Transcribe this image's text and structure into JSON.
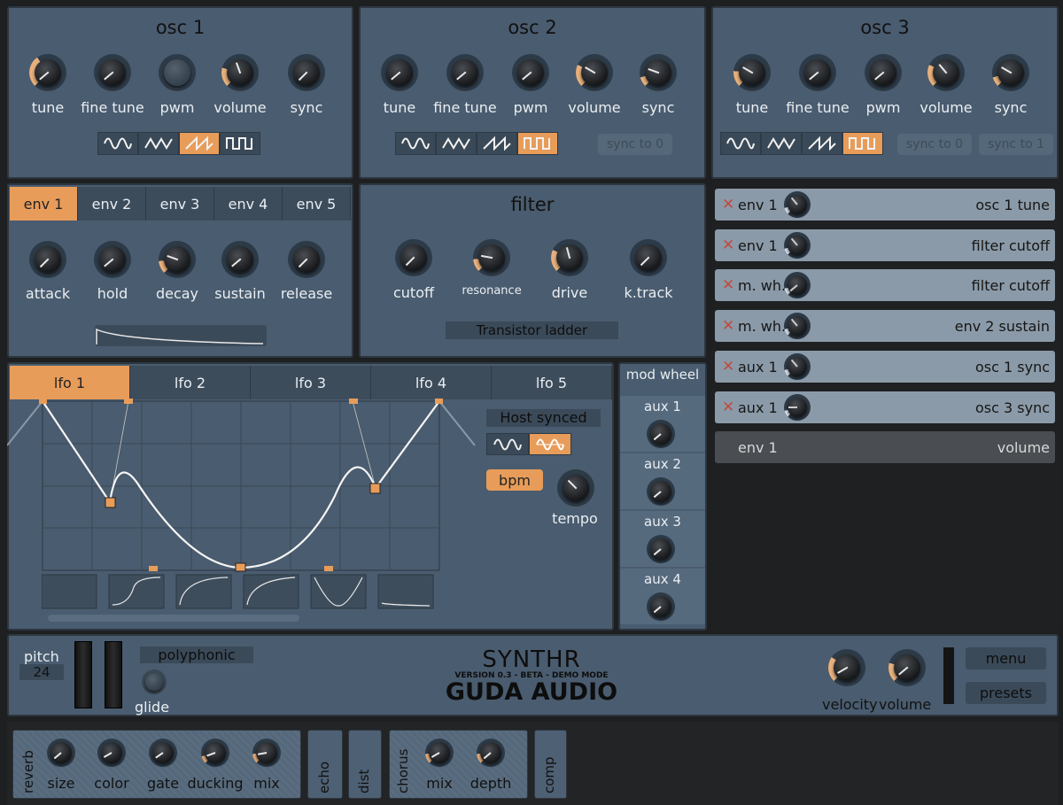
{
  "osc": [
    {
      "title": "osc 1",
      "knobs": [
        "tune",
        "fine tune",
        "pwm",
        "volume",
        "sync"
      ],
      "wave_selected": 2,
      "sync_buttons": []
    },
    {
      "title": "osc 2",
      "knobs": [
        "tune",
        "fine tune",
        "pwm",
        "volume",
        "sync"
      ],
      "wave_selected": 3,
      "sync_buttons": [
        "sync to 0"
      ]
    },
    {
      "title": "osc 3",
      "knobs": [
        "tune",
        "fine tune",
        "pwm",
        "volume",
        "sync"
      ],
      "wave_selected": 3,
      "sync_buttons": [
        "sync to 0",
        "sync to 1"
      ]
    }
  ],
  "env": {
    "tabs": [
      "env 1",
      "env 2",
      "env 3",
      "env 4",
      "env 5"
    ],
    "selected": 0,
    "knobs": [
      "attack",
      "hold",
      "decay",
      "sustain",
      "release"
    ]
  },
  "filter": {
    "title": "filter",
    "knobs": [
      "cutoff",
      "resonance",
      "drive",
      "k.track"
    ],
    "type": "Transistor ladder"
  },
  "mod_matrix": [
    {
      "source": "env 1",
      "dest": "osc 1 tune",
      "removable": true
    },
    {
      "source": "env 1",
      "dest": "filter cutoff",
      "removable": true
    },
    {
      "source": "m. wh.",
      "dest": "filter cutoff",
      "removable": true
    },
    {
      "source": "m. wh.",
      "dest": "env 2 sustain",
      "removable": true
    },
    {
      "source": "aux 1",
      "dest": "osc 1 sync",
      "removable": true
    },
    {
      "source": "aux 1",
      "dest": "osc 3 sync",
      "removable": true
    },
    {
      "source": "env 1",
      "dest": "volume",
      "removable": false
    }
  ],
  "lfo": {
    "tabs": [
      "lfo 1",
      "lfo 2",
      "lfo 3",
      "lfo 4",
      "lfo 5"
    ],
    "selected": 0,
    "host_synced": "Host synced",
    "bpm": "bpm",
    "tempo": "tempo"
  },
  "mod_wheel": {
    "title": "mod wheel",
    "aux": [
      "aux 1",
      "aux 2",
      "aux 3",
      "aux 4"
    ]
  },
  "footer": {
    "pitch_label": "pitch",
    "pitch_value": "24",
    "mode": "polyphonic",
    "glide": "glide",
    "brand_title": "SYNTHR",
    "brand_version": "VERSION 0.3 - BETA - DEMO MODE",
    "brand_company": "GUDA AUDIO",
    "velocity": "velocity",
    "volume": "volume",
    "menu": "menu",
    "presets": "presets"
  },
  "effects": {
    "reverb": {
      "label": "reverb",
      "knobs": [
        "size",
        "color",
        "gate",
        "ducking",
        "mix"
      ]
    },
    "echo": "echo",
    "dist": "dist",
    "chorus": {
      "label": "chorus",
      "knobs": [
        "mix",
        "depth"
      ]
    },
    "comp": "comp"
  },
  "colors": {
    "panel": "#4a5c6f",
    "accent": "#e89c5a",
    "background": "#1e1f21"
  }
}
